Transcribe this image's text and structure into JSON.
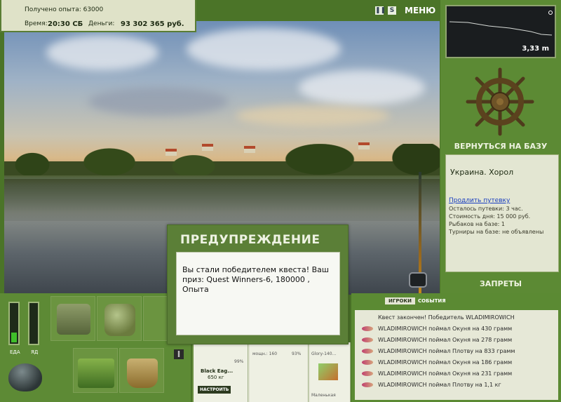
{
  "header": {
    "experience": "Получено опыта: 63000",
    "time_label": "Время:",
    "time_value": "20:30 СБ",
    "money_label": "Деньги:",
    "money_value": "93 302 365 руб.",
    "menu_label": "МЕНЮ",
    "pause_icon": "pause-icon",
    "sound_icon": "sound-icon"
  },
  "depth": {
    "value": "3,33 m"
  },
  "base": {
    "return_label": "ВЕРНУТЬСЯ НА БАЗУ",
    "location": "Украина. Хорол",
    "extend_link": "Продлить путевку",
    "lines": [
      "Осталось путевки: 3 час.",
      "Стоимость дня: 15 000 руб.",
      "Рыбаков на базе: 1",
      "Турниры на базе: не объявлены"
    ],
    "bans_label": "ЗАПРЕТЫ"
  },
  "stats": {
    "food_label": "ЕДА",
    "poison_label": "ЯД",
    "food_level": 0.25,
    "poison_level": 0.0
  },
  "rod": {
    "name": "Black Eag...",
    "weight": "650 кг",
    "setup_label": "НАСТРОИТЬ",
    "percent1": "99%",
    "power_label": "мощн.: 160",
    "percent2": "93%",
    "glory": "Glory-140...",
    "small": "Маленькая"
  },
  "events": {
    "tab_players": "ИГРОКИ",
    "tab_events": "СОБЫТИЯ",
    "items": [
      "Квест закончен! Победитель WLADIMIROWICH",
      "WLADIMIROWICH поймал Окуня на 430 грамм",
      "WLADIMIROWICH поймал Окуня на 278 грамм",
      "WLADIMIROWICH поймал Плотву на 833 грамм",
      "WLADIMIROWICH поймал Окуня на 186 грамм",
      "WLADIMIROWICH поймал Окуня на 231 грамм",
      "WLADIMIROWICH поймал Плотву на 1,1 кг"
    ]
  },
  "dialog": {
    "title": "ПРЕДУПРЕЖДЕНИЕ",
    "message": "Вы стали победителем квеста! Ваш приз: Quest Winners-6, 180000 , Опыта"
  }
}
